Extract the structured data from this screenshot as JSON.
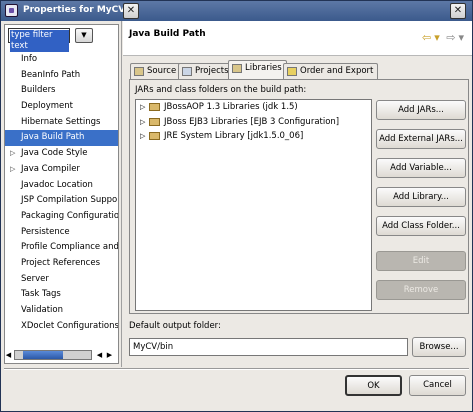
{
  "window": {
    "title": "Properties for MyCV",
    "close_symbol": "✕"
  },
  "filter": {
    "value": "type filter text",
    "dropdown_symbol": "▼"
  },
  "tree": [
    {
      "label": "Info",
      "expandable": false
    },
    {
      "label": "BeanInfo Path",
      "expandable": false
    },
    {
      "label": "Builders",
      "expandable": false
    },
    {
      "label": "Deployment",
      "expandable": false
    },
    {
      "label": "Hibernate Settings",
      "expandable": false
    },
    {
      "label": "Java Build Path",
      "expandable": false,
      "selected": true
    },
    {
      "label": "Java Code Style",
      "expandable": true
    },
    {
      "label": "Java Compiler",
      "expandable": true
    },
    {
      "label": "Javadoc Location",
      "expandable": false
    },
    {
      "label": "JSP Compilation Suppor",
      "expandable": false
    },
    {
      "label": "Packaging Configuratio",
      "expandable": false
    },
    {
      "label": "Persistence",
      "expandable": false
    },
    {
      "label": "Profile Compliance and",
      "expandable": false
    },
    {
      "label": "Project References",
      "expandable": false
    },
    {
      "label": "Server",
      "expandable": false
    },
    {
      "label": "Task Tags",
      "expandable": false
    },
    {
      "label": "Validation",
      "expandable": false
    },
    {
      "label": "XDoclet Configurations",
      "expandable": false
    }
  ],
  "header": {
    "title": "Java Build Path",
    "back_symbol": "⇦",
    "forward_symbol": "⇨",
    "dropdown_symbol": "▾"
  },
  "tabs": [
    {
      "label": "Source",
      "active": false
    },
    {
      "label": "Projects",
      "active": false
    },
    {
      "label": "Libraries",
      "active": true
    },
    {
      "label": "Order and Export",
      "active": false
    }
  ],
  "panel": {
    "label": "JARs and class folders on the build path:",
    "libraries": [
      "JBossAOP 1.3 Libraries (jdk 1.5)",
      "JBoss EJB3 Libraries [EJB 3 Configuration]",
      "JRE System Library [jdk1.5.0_06]"
    ],
    "buttons": [
      {
        "label": "Add JARs...",
        "enabled": true
      },
      {
        "label": "Add External JARs...",
        "enabled": true
      },
      {
        "label": "Add Variable...",
        "enabled": true
      },
      {
        "label": "Add Library...",
        "enabled": true
      },
      {
        "label": "Add Class Folder...",
        "enabled": true
      },
      {
        "label": "Edit",
        "enabled": false
      },
      {
        "label": "Remove",
        "enabled": false
      }
    ]
  },
  "output": {
    "label": "Default output folder:",
    "value": "MyCV/bin",
    "browse_label": "Browse..."
  },
  "dialog": {
    "ok_label": "OK",
    "cancel_label": "Cancel"
  },
  "icons": {
    "expand": "▷",
    "scroll_left": "◀",
    "scroll_right": "▶"
  }
}
